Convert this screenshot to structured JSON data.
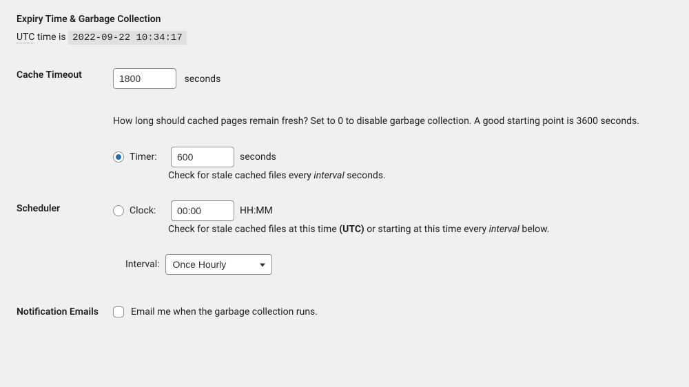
{
  "section_title": "Expiry Time & Garbage Collection",
  "utc_label": "UTC",
  "time_is_text": " time is ",
  "timestamp": "2022-09-22 10:34:17",
  "cache_timeout": {
    "label": "Cache Timeout",
    "value": "1800",
    "unit": "seconds",
    "help": "How long should cached pages remain fresh? Set to 0 to disable garbage collection. A good starting point is 3600 seconds."
  },
  "scheduler": {
    "label": "Scheduler",
    "timer": {
      "label": "Timer:",
      "value": "600",
      "unit": "seconds",
      "desc_pre": "Check for stale cached files every ",
      "desc_em": "interval",
      "desc_post": " seconds."
    },
    "clock": {
      "label": "Clock:",
      "value": "00:00",
      "unit": "HH:MM",
      "desc_pre": "Check for stale cached files at this time ",
      "desc_bold": "(UTC)",
      "desc_mid": " or starting at this time every ",
      "desc_em": "interval",
      "desc_post": " below."
    },
    "interval": {
      "label": "Interval:",
      "selected": "Once Hourly"
    }
  },
  "notification": {
    "label": "Notification Emails",
    "checkbox_label": "Email me when the garbage collection runs."
  }
}
